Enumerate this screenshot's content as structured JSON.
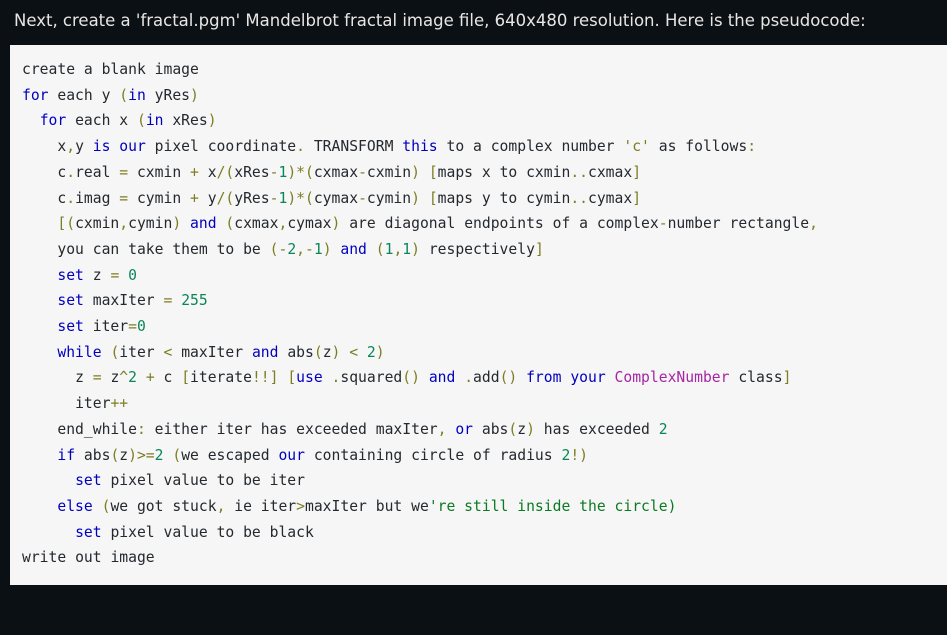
{
  "theme": {
    "page_background": "#0b1014",
    "code_background": "#f6f6f6",
    "intro_text_color": "#e8e6e3",
    "code_text_color": "#24292e",
    "keyword_color": "#0000c0",
    "number_color": "#098658",
    "string_color": "#7d7d23",
    "class_color": "#a626a4",
    "green_run_color": "#0b7a22"
  },
  "intro": {
    "text": "Next, create a 'fractal.pgm' Mandelbrot fractal image file, 640x480 resolution. Here is the pseudocode:"
  },
  "code": {
    "language": "pseudocode",
    "lines": [
      {
        "id": "l1",
        "text": "create a blank image"
      },
      {
        "id": "l2",
        "text": "for each y (in yRes)"
      },
      {
        "id": "l3",
        "text": "  for each x (in xRes)"
      },
      {
        "id": "l4",
        "text": "    x,y is our pixel coordinate. TRANSFORM this to a complex number 'c' as follows:"
      },
      {
        "id": "l5",
        "text": "    c.real = cxmin + x/(xRes-1)*(cxmax-cxmin) [maps x to cxmin..cxmax]"
      },
      {
        "id": "l6",
        "text": "    c.imag = cymin + y/(yRes-1)*(cymax-cymin) [maps y to cymin..cymax]"
      },
      {
        "id": "l7",
        "text": "    [(cxmin,cymin) and (cxmax,cymax) are diagonal endpoints of a complex-number rectangle,"
      },
      {
        "id": "l8",
        "text": "    you can take them to be (-2,-1) and (1,1) respectively]"
      },
      {
        "id": "l9",
        "text": "    set z = 0"
      },
      {
        "id": "l10",
        "text": "    set maxIter = 255"
      },
      {
        "id": "l11",
        "text": "    set iter=0"
      },
      {
        "id": "l12",
        "text": "    while (iter < maxIter and abs(z) < 2)"
      },
      {
        "id": "l13",
        "text": "      z = z^2 + c [iterate!!] [use .squared() and .add() from your ComplexNumber class]"
      },
      {
        "id": "l14",
        "text": "      iter++"
      },
      {
        "id": "l15",
        "text": "    end_while: either iter has exceeded maxIter, or abs(z) has exceeded 2"
      },
      {
        "id": "l16",
        "text": "    if abs(z)>=2 (we escaped our containing circle of radius 2!)"
      },
      {
        "id": "l17",
        "text": "      set pixel value to be iter"
      },
      {
        "id": "l18",
        "text": "    else (we got stuck, ie iter>maxIter but we're still inside the circle)"
      },
      {
        "id": "l19",
        "text": "      set pixel value to be black"
      },
      {
        "id": "l20",
        "text": "write out image"
      }
    ]
  }
}
